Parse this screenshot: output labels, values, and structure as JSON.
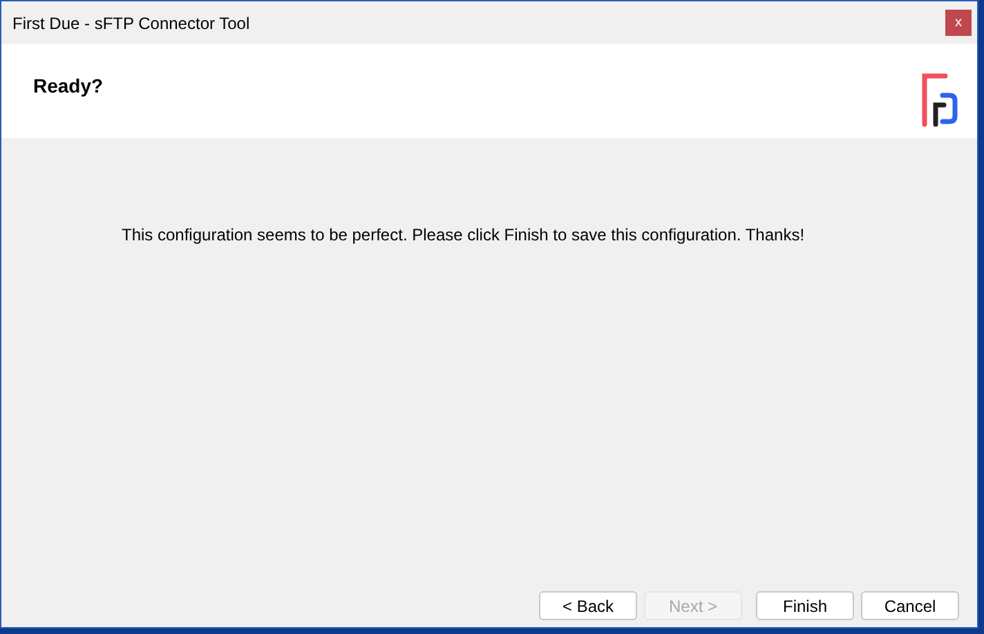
{
  "window": {
    "title": "First Due - sFTP Connector Tool",
    "close": "x"
  },
  "header": {
    "title": "Ready?"
  },
  "message": "This configuration seems to be perfect. Please click Finish to save this configuration. Thanks!",
  "buttons": [
    {
      "label": "< Back",
      "disabled": false
    },
    {
      "label": "Next >",
      "disabled": true
    },
    {
      "label": "Finish",
      "disabled": false
    },
    {
      "label": "Cancel",
      "disabled": false
    }
  ]
}
